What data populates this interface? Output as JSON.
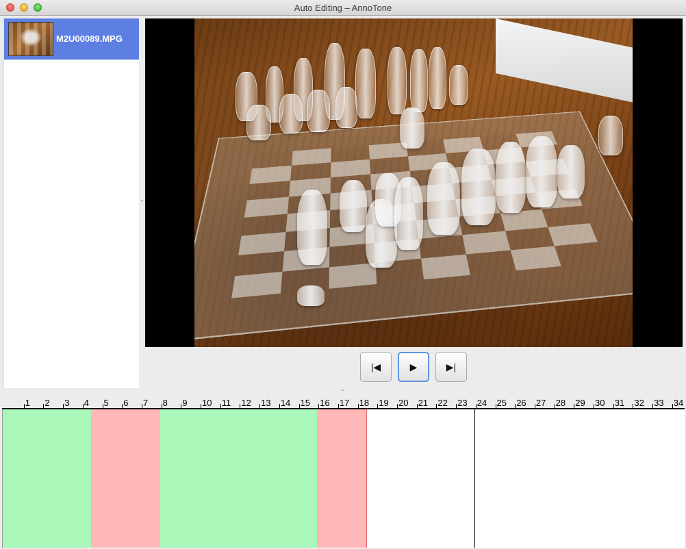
{
  "window": {
    "title": "Auto Editing – AnnoTone"
  },
  "clips": [
    {
      "name": "M2U00089.MPG",
      "selected": true
    }
  ],
  "controls": {
    "prev_label": "|◀",
    "play_label": "▶",
    "next_label": "▶|",
    "prev_icon": "skip-to-start-icon",
    "play_icon": "play-icon",
    "next_icon": "skip-to-end-icon"
  },
  "timeline": {
    "tick_labels": [
      "1",
      "2",
      "3",
      "4",
      "5",
      "6",
      "7",
      "8",
      "9",
      "10",
      "11",
      "12",
      "13",
      "14",
      "15",
      "16",
      "17",
      "18",
      "19",
      "20",
      "21",
      "22",
      "23",
      "24",
      "25",
      "26",
      "27",
      "28",
      "29",
      "30",
      "31",
      "32",
      "33",
      "34"
    ],
    "segments": [
      {
        "start": 0.0,
        "end": 4.5,
        "state": "keep"
      },
      {
        "start": 4.5,
        "end": 8.0,
        "state": "cut"
      },
      {
        "start": 8.0,
        "end": 16.0,
        "state": "keep"
      },
      {
        "start": 16.0,
        "end": 18.5,
        "state": "cut"
      }
    ],
    "playhead": 24.0,
    "colors": {
      "keep": "#a9f7b9",
      "cut": "#ffb7b7"
    }
  }
}
